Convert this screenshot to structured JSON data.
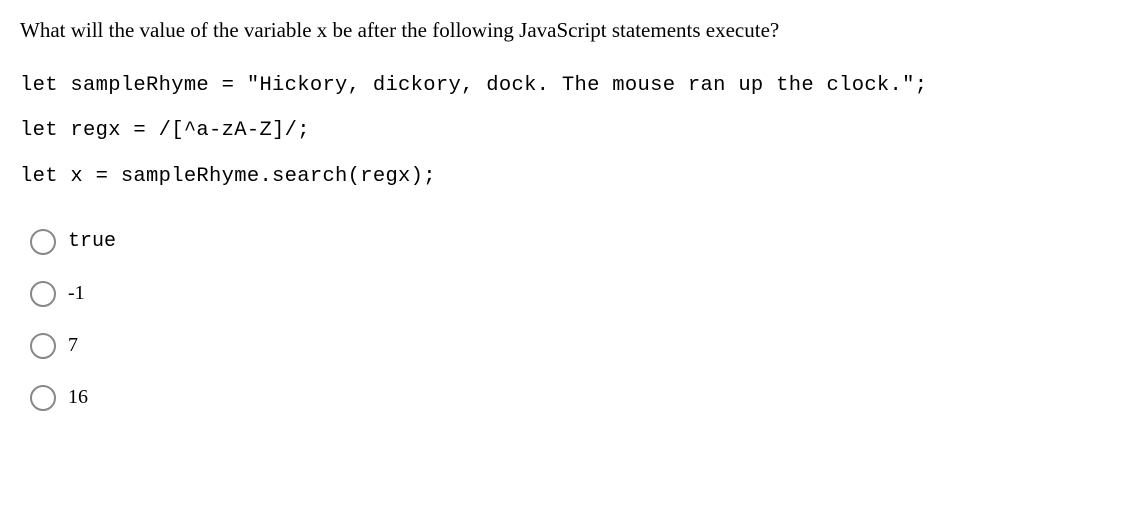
{
  "question": "What will the value of the variable x be after the following JavaScript statements execute?",
  "code": {
    "line1": "let sampleRhyme = \"Hickory, dickory, dock. The mouse ran up the clock.\";",
    "line2": "let regx = /[^a-zA-Z]/;",
    "line3": "let x = sampleRhyme.search(regx);"
  },
  "options": [
    {
      "label": "true",
      "mono": true
    },
    {
      "label": "-1",
      "mono": false
    },
    {
      "label": "7",
      "mono": false
    },
    {
      "label": "16",
      "mono": false
    }
  ]
}
